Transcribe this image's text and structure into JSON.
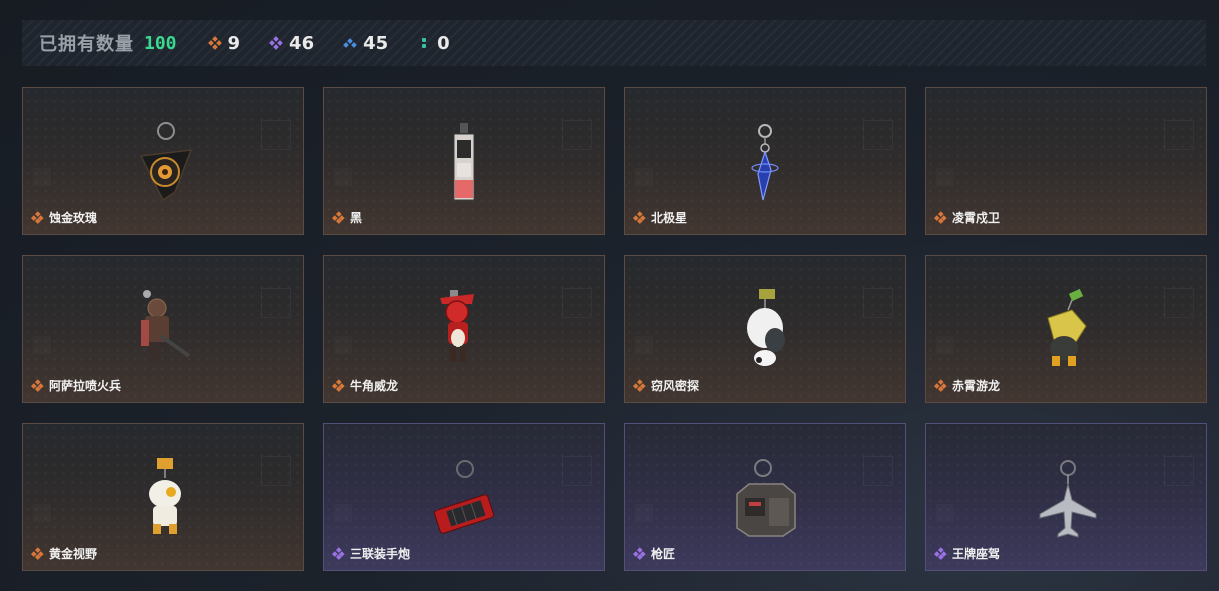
{
  "stats": {
    "owned_label": "已拥有数量",
    "owned_total": "100",
    "counts": [
      {
        "tier": "orange",
        "icon": "orange-diamond-icon",
        "value": "9"
      },
      {
        "tier": "purple",
        "icon": "purple-diamond-icon",
        "value": "46"
      },
      {
        "tier": "blue",
        "icon": "blue-diamond-icon",
        "value": "45"
      },
      {
        "tier": "green",
        "icon": "green-dots-icon",
        "value": "0"
      }
    ]
  },
  "colors": {
    "orange_tier": "#d9773a",
    "purple_tier": "#9a72e6",
    "blue_tier": "#4a8fe0",
    "green_tier": "#3ac0a0",
    "total_accent": "#3ad890"
  },
  "items": [
    {
      "name": "蚀金玫瑰",
      "tier": "orange",
      "icon": "golden-rose-charm-icon"
    },
    {
      "name": "黑",
      "tier": "orange",
      "icon": "black-tag-charm-icon"
    },
    {
      "name": "北极星",
      "tier": "orange",
      "icon": "polaris-charm-icon"
    },
    {
      "name": "凌霄戍卫",
      "tier": "orange",
      "icon": "empty-slot"
    },
    {
      "name": "阿萨拉喷火兵",
      "tier": "orange",
      "icon": "flamethrower-figure-charm-icon"
    },
    {
      "name": "牛角威龙",
      "tier": "orange",
      "icon": "horned-dragon-figure-charm-icon"
    },
    {
      "name": "窃风密探",
      "tier": "orange",
      "icon": "white-hood-figure-charm-icon"
    },
    {
      "name": "赤霄游龙",
      "tier": "orange",
      "icon": "gold-dragon-figure-charm-icon"
    },
    {
      "name": "黄金视野",
      "tier": "orange",
      "icon": "golden-vision-figure-charm-icon"
    },
    {
      "name": "三联装手炮",
      "tier": "purple",
      "icon": "triple-hand-cannon-charm-icon"
    },
    {
      "name": "枪匠",
      "tier": "purple",
      "icon": "gunsmith-badge-charm-icon"
    },
    {
      "name": "王牌座驾",
      "tier": "purple",
      "icon": "ace-jet-charm-icon"
    }
  ]
}
